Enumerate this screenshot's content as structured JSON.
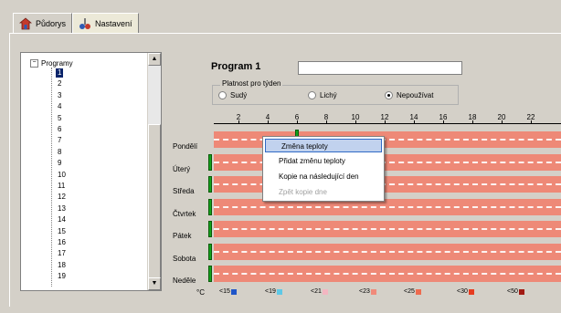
{
  "tabs": [
    {
      "label": "Půdorys",
      "icon": "house-icon"
    },
    {
      "label": "Nastavení",
      "icon": "settings-tools-icon"
    }
  ],
  "tree": {
    "root": "Programy",
    "items": [
      "1",
      "2",
      "3",
      "4",
      "5",
      "6",
      "7",
      "8",
      "9",
      "10",
      "11",
      "12",
      "13",
      "14",
      "15",
      "16",
      "17",
      "18",
      "19"
    ],
    "selected": "1"
  },
  "program": {
    "title": "Program 1",
    "name_value": ""
  },
  "week_validity": {
    "label": "Platnost pro týden",
    "options": [
      "Sudý",
      "Lichý",
      "Nepoužívat"
    ],
    "selected": "Nepoužívat"
  },
  "hours": [
    "2",
    "4",
    "6",
    "8",
    "10",
    "12",
    "14",
    "16",
    "18",
    "20",
    "22"
  ],
  "days": [
    "Pondělí",
    "Úterý",
    "Středa",
    "Čtvrtek",
    "Pátek",
    "Sobota",
    "Neděle"
  ],
  "context_menu": {
    "items": [
      "Změna teploty",
      "Přidat změnu teploty",
      "Kopie na následující den",
      "Zpět kopie dne"
    ],
    "highlighted": "Změna teploty",
    "disabled": [
      "Zpět kopie dne"
    ]
  },
  "legend": {
    "unit": "°C",
    "entries": [
      {
        "label": "<15",
        "color": "#1f55c8"
      },
      {
        "label": "<19",
        "color": "#5ec8e6"
      },
      {
        "label": "<21",
        "color": "#f3b6c1"
      },
      {
        "label": "<23",
        "color": "#f08a7a"
      },
      {
        "label": "<25",
        "color": "#ee6b4f"
      },
      {
        "label": "<30",
        "color": "#e63c20"
      },
      {
        "label": "<50",
        "color": "#a11a12"
      }
    ]
  },
  "colors": {
    "bar": "#ee8977",
    "marker": "#13a01b",
    "selection": "#0a246a"
  }
}
